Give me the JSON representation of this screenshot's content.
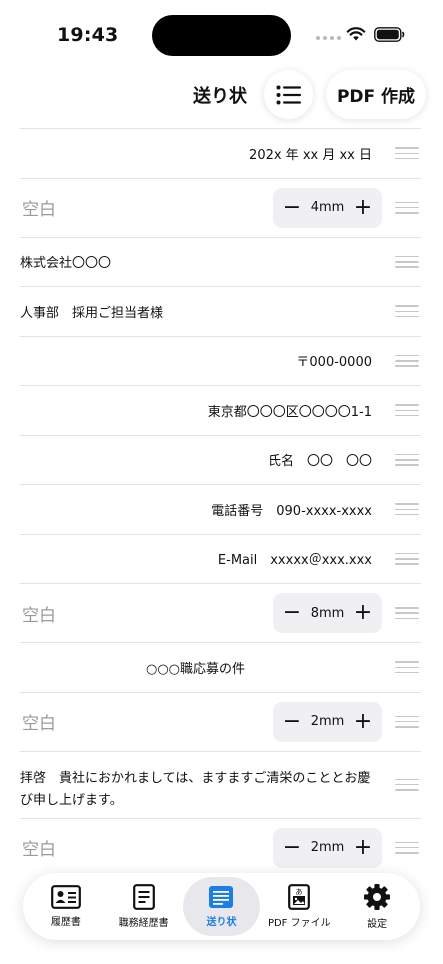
{
  "status_bar": {
    "time": "19:43"
  },
  "header": {
    "title": "送り状",
    "pdf_button": "PDF 作成",
    "list_icon": "list-icon"
  },
  "rows": {
    "date": "202x 年 xx 月 xx 日",
    "blank1": {
      "label": "空白",
      "value": "4mm"
    },
    "company": "株式会社〇〇〇",
    "recipient": "人事部　採用ご担当者様",
    "postal": "〒000-0000",
    "address": "東京都〇〇〇区〇〇〇〇1-1",
    "name": "氏名　〇〇　〇〇",
    "phone": "電話番号　090-xxxx-xxxx",
    "email": "E-Mail　xxxxx＠xxx.xxx",
    "blank2": {
      "label": "空白",
      "value": "8mm"
    },
    "subject": "○○○職応募の件",
    "blank3": {
      "label": "空白",
      "value": "2mm"
    },
    "greeting": "拝啓　貴社におかれましては、ますますご清栄のこととお慶び申し上げます。",
    "blank4": {
      "label": "空白",
      "value": "2mm"
    },
    "stepper_minus": "−",
    "stepper_plus": "+"
  },
  "tabs": [
    {
      "label": "履歴書",
      "icon": "id-card-icon"
    },
    {
      "label": "職務経歴書",
      "icon": "document-icon"
    },
    {
      "label": "送り状",
      "icon": "letter-icon",
      "active": true
    },
    {
      "label": "PDF ファイル",
      "icon": "pdf-file-icon"
    },
    {
      "label": "設定",
      "icon": "gear-icon"
    }
  ],
  "colors": {
    "accent": "#1a7ee6",
    "stepper_bg": "#f0f0f3",
    "placeholder": "#9a9a9a"
  }
}
